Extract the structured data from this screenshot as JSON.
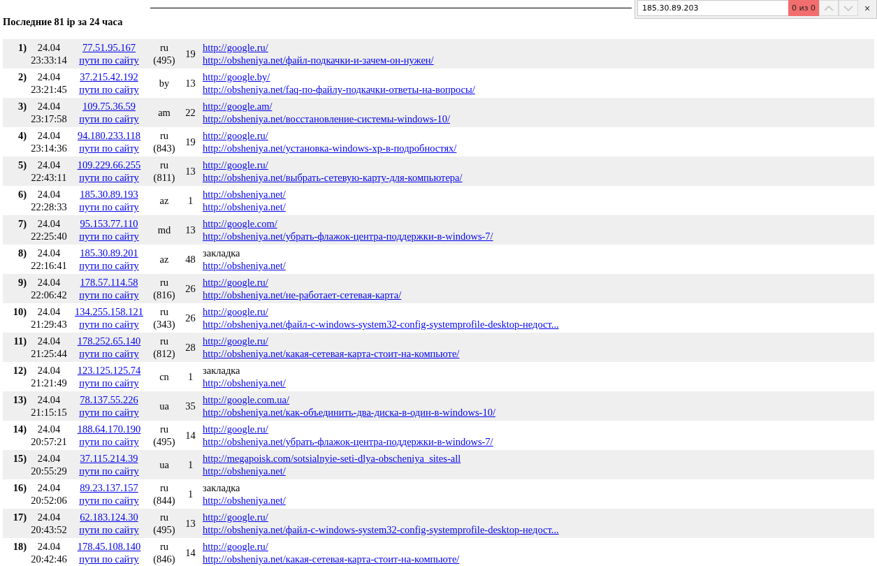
{
  "title": "Последние 81 ip за 24 часа",
  "find_bar": {
    "value": "185.30.89.203",
    "result": "0 из 0",
    "close": "×"
  },
  "rows": [
    {
      "num": "1)",
      "date": "24.04",
      "time": "23:33:14",
      "ip": "77.51.95.167",
      "paths": "пути по сайту",
      "country": "ru",
      "code": "(495)",
      "count": "19",
      "referrer": {
        "kind": "link",
        "text": "http://google.ru/"
      },
      "page": "http://obsheniya.net/файл-подкачки-и-зачем-он-нужен/"
    },
    {
      "num": "2)",
      "date": "24.04",
      "time": "23:21:45",
      "ip": "37.215.42.192",
      "paths": "пути по сайту",
      "country": "by",
      "count": "13",
      "referrer": {
        "kind": "link",
        "text": "http://google.by/"
      },
      "page": "http://obsheniya.net/faq-по-файлу-подкачки-ответы-на-вопросы/"
    },
    {
      "num": "3)",
      "date": "24.04",
      "time": "23:17:58",
      "ip": "109.75.36.59",
      "paths": "пути по сайту",
      "country": "am",
      "count": "22",
      "referrer": {
        "kind": "link",
        "text": "http://google.am/"
      },
      "page": "http://obsheniya.net/восстановление-системы-windows-10/"
    },
    {
      "num": "4)",
      "date": "24.04",
      "time": "23:14:36",
      "ip": "94.180.233.118",
      "paths": "пути по сайту",
      "country": "ru",
      "code": "(843)",
      "count": "19",
      "referrer": {
        "kind": "link",
        "text": "http://google.ru/"
      },
      "page": "http://obsheniya.net/установка-windows-xp-в-подробностях/"
    },
    {
      "num": "5)",
      "date": "24.04",
      "time": "22:43:11",
      "ip": "109.229.66.255",
      "paths": "пути по сайту",
      "country": "ru",
      "code": "(811)",
      "count": "13",
      "referrer": {
        "kind": "link",
        "text": "http://google.ru/"
      },
      "page": "http://obsheniya.net/выбрать-сетевую-карту-для-компьютера/"
    },
    {
      "num": "6)",
      "date": "24.04",
      "time": "22:28:33",
      "ip": "185.30.89.193",
      "paths": "пути по сайту",
      "country": "az",
      "count": "1",
      "referrer": {
        "kind": "link",
        "text": "http://obsheniya.net/"
      },
      "page": "http://obsheniya.net/"
    },
    {
      "num": "7)",
      "date": "24.04",
      "time": "22:25:40",
      "ip": "95.153.77.110",
      "paths": "пути по сайту",
      "country": "md",
      "count": "13",
      "referrer": {
        "kind": "link",
        "text": "http://google.com/"
      },
      "page": "http://obsheniya.net/убрать-флажок-центра-поддержки-в-windows-7/"
    },
    {
      "num": "8)",
      "date": "24.04",
      "time": "22:16:41",
      "ip": "185.30.89.201",
      "paths": "пути по сайту",
      "country": "az",
      "count": "48",
      "referrer": {
        "kind": "text",
        "text": "закладка"
      },
      "page": "http://obsheniya.net/"
    },
    {
      "num": "9)",
      "date": "24.04",
      "time": "22:06:42",
      "ip": "178.57.114.58",
      "paths": "пути по сайту",
      "country": "ru",
      "code": "(816)",
      "count": "26",
      "referrer": {
        "kind": "link",
        "text": "http://google.ru/"
      },
      "page": "http://obsheniya.net/не-работает-сетевая-карта/"
    },
    {
      "num": "10)",
      "date": "24.04",
      "time": "21:29:43",
      "ip": "134.255.158.121",
      "paths": "пути по сайту",
      "country": "ru",
      "code": "(343)",
      "count": "26",
      "referrer": {
        "kind": "link",
        "text": "http://google.ru/"
      },
      "page": "http://obsheniya.net/файл-c-windows-system32-config-systemprofile-desktop-недост..."
    },
    {
      "num": "11)",
      "date": "24.04",
      "time": "21:25:44",
      "ip": "178.252.65.140",
      "paths": "пути по сайту",
      "country": "ru",
      "code": "(812)",
      "count": "28",
      "referrer": {
        "kind": "link",
        "text": "http://google.ru/"
      },
      "page": "http://obsheniya.net/какая-сетевая-карта-стоит-на-компьюте/"
    },
    {
      "num": "12)",
      "date": "24.04",
      "time": "21:21:49",
      "ip": "123.125.125.74",
      "paths": "пути по сайту",
      "country": "cn",
      "count": "1",
      "referrer": {
        "kind": "text",
        "text": "закладка"
      },
      "page": "http://obsheniya.net/"
    },
    {
      "num": "13)",
      "date": "24.04",
      "time": "21:15:15",
      "ip": "78.137.55.226",
      "paths": "пути по сайту",
      "country": "ua",
      "count": "35",
      "referrer": {
        "kind": "link",
        "text": "http://google.com.ua/"
      },
      "page": "http://obsheniya.net/как-объединить-два-диска-в-один-в-windows-10/"
    },
    {
      "num": "14)",
      "date": "24.04",
      "time": "20:57:21",
      "ip": "188.64.170.190",
      "paths": "пути по сайту",
      "country": "ru",
      "code": "(495)",
      "count": "14",
      "referrer": {
        "kind": "link",
        "text": "http://google.ru/"
      },
      "page": "http://obsheniya.net/убрать-флажок-центра-поддержки-в-windows-7/"
    },
    {
      "num": "15)",
      "date": "24.04",
      "time": "20:55:29",
      "ip": "37.115.214.39",
      "paths": "пути по сайту",
      "country": "ua",
      "count": "1",
      "referrer": {
        "kind": "link",
        "text": "http://megapoisk.com/sotsialnyie-seti-dlya-obscheniya_sites-all"
      },
      "page": "http://obsheniya.net/"
    },
    {
      "num": "16)",
      "date": "24.04",
      "time": "20:52:06",
      "ip": "89.23.137.157",
      "paths": "пути по сайту",
      "country": "ru",
      "code": "(844)",
      "count": "1",
      "referrer": {
        "kind": "text",
        "text": "закладка"
      },
      "page": "http://obsheniya.net/"
    },
    {
      "num": "17)",
      "date": "24.04",
      "time": "20:43:52",
      "ip": "62.183.124.30",
      "paths": "пути по сайту",
      "country": "ru",
      "code": "(495)",
      "count": "13",
      "referrer": {
        "kind": "link",
        "text": "http://google.ru/"
      },
      "page": "http://obsheniya.net/файл-c-windows-system32-config-systemprofile-desktop-недост..."
    },
    {
      "num": "18)",
      "date": "24.04",
      "time": "20:42:46",
      "ip": "178.45.108.140",
      "paths": "пути по сайту",
      "country": "ru",
      "code": "(846)",
      "count": "14",
      "referrer": {
        "kind": "link",
        "text": "http://google.ru/"
      },
      "page": "http://obsheniya.net/какая-сетевая-карта-стоит-на-компьюте/"
    }
  ]
}
